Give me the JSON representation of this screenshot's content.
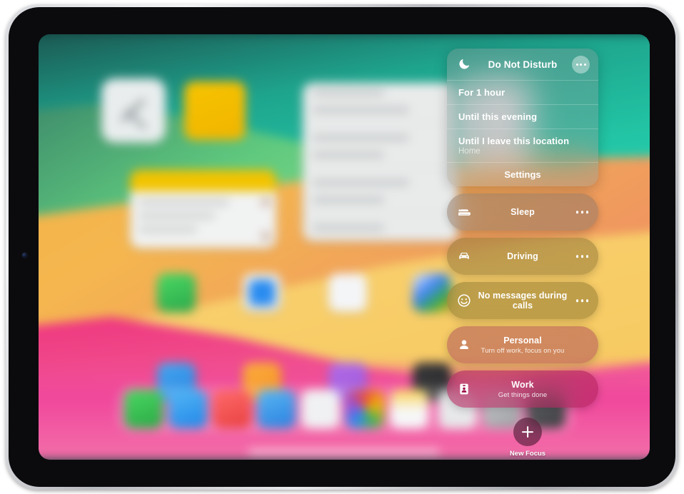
{
  "device": {
    "name": "iPad",
    "orientation": "landscape"
  },
  "focus_panel": {
    "do_not_disturb": {
      "title": "Do Not Disturb",
      "icon": "moon-icon",
      "more_icon": "ellipsis-icon",
      "options": [
        {
          "label": "For 1 hour",
          "sublabel": ""
        },
        {
          "label": "Until this evening",
          "sublabel": ""
        },
        {
          "label": "Until I leave this location",
          "sublabel": "Home"
        }
      ],
      "settings_label": "Settings"
    },
    "modes": [
      {
        "id": "sleep",
        "title": "Sleep",
        "subtitle": "",
        "icon": "bed-icon",
        "more_icon": "ellipsis-icon"
      },
      {
        "id": "driving",
        "title": "Driving",
        "subtitle": "",
        "icon": "car-icon",
        "more_icon": "ellipsis-icon"
      },
      {
        "id": "nomsg",
        "title": "No messages during calls",
        "subtitle": "",
        "icon": "smiley-icon",
        "more_icon": "ellipsis-icon"
      },
      {
        "id": "personal",
        "title": "Personal",
        "subtitle": "Turn off work, focus on you",
        "icon": "person-icon",
        "more_icon": "ellipsis-icon"
      },
      {
        "id": "work",
        "title": "Work",
        "subtitle": "Get things done",
        "icon": "badge-icon",
        "more_icon": "ellipsis-icon"
      }
    ],
    "new_focus": {
      "label": "New Focus",
      "icon": "plus-icon"
    }
  },
  "home_screen": {
    "home_indicator": "home-indicator",
    "wallpaper_colors": {
      "teal": "#22c6a6",
      "green": "#8ee08a",
      "orange": "#f0a05c",
      "yellow": "#f6c85f",
      "pink": "#ef2f79"
    }
  }
}
